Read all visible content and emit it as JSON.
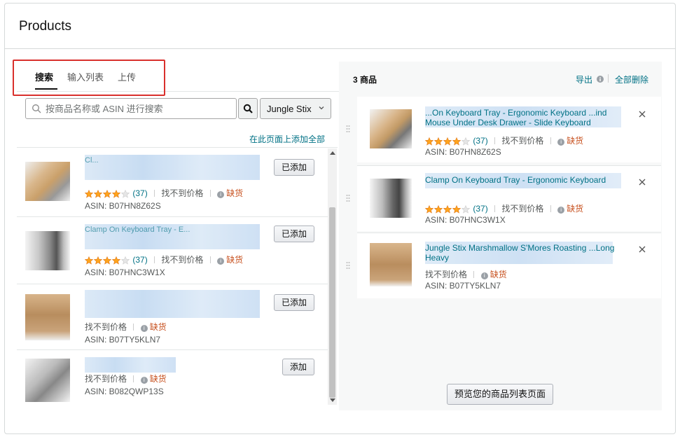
{
  "page_title": "Products",
  "tabs": [
    {
      "label": "搜索",
      "active": true
    },
    {
      "label": "输入列表",
      "active": false
    },
    {
      "label": "上传",
      "active": false
    }
  ],
  "search": {
    "placeholder": "按商品名称或 ASIN 进行搜索",
    "brand": "Jungle Stix"
  },
  "add_all_label": "在此页面上添加全部",
  "results": [
    {
      "rating": 4,
      "reviews": "(37)",
      "price": "找不到价格",
      "stock": "缺货",
      "asin": "ASIN: B07HN8Z62S",
      "button": "已添加",
      "title": "Cl..."
    },
    {
      "rating": 4,
      "reviews": "(37)",
      "price": "找不到价格",
      "stock": "缺货",
      "asin": "ASIN: B07HNC3W1X",
      "button": "已添加",
      "title": "Clamp On Keyboard Tray - E..."
    },
    {
      "rating": 0,
      "reviews": "",
      "price": "找不到价格",
      "stock": "缺货",
      "asin": "ASIN: B07TY5KLN7",
      "button": "已添加",
      "title": ""
    },
    {
      "rating": 0,
      "reviews": "",
      "price": "找不到价格",
      "stock": "缺货",
      "asin": "ASIN: B082QWP13S",
      "button": "添加",
      "title": ""
    }
  ],
  "selected": {
    "count_label": "3 商品",
    "export_label": "导出",
    "delete_all_label": "全部删除",
    "items": [
      {
        "title": "...On Keyboard Tray - Ergonomic Keyboard ...ind Mouse Under Desk Drawer - Slide Keyboard",
        "rating": 4,
        "reviews": "(37)",
        "price": "找不到价格",
        "stock": "缺货",
        "asin": "ASIN: B07HN8Z62S"
      },
      {
        "title": "Clamp On Keyboard Tray - Ergonomic Keyboard",
        "rating": 4,
        "reviews": "(37)",
        "price": "找不到价格",
        "stock": "缺货",
        "asin": "ASIN: B07HNC3W1X"
      },
      {
        "title": "Jungle Stix Marshmallow S'Mores Roasting ...Long Heavy",
        "rating": 0,
        "reviews": "",
        "price": "找不到价格",
        "stock": "缺货",
        "asin": "ASIN: B07TY5KLN7"
      }
    ]
  },
  "preview_label": "预览您的商品列表页面",
  "colors": {
    "link": "#007185",
    "out_of_stock": "#c7511f",
    "star": "#ffa41c",
    "highlight": "#d9302c"
  }
}
